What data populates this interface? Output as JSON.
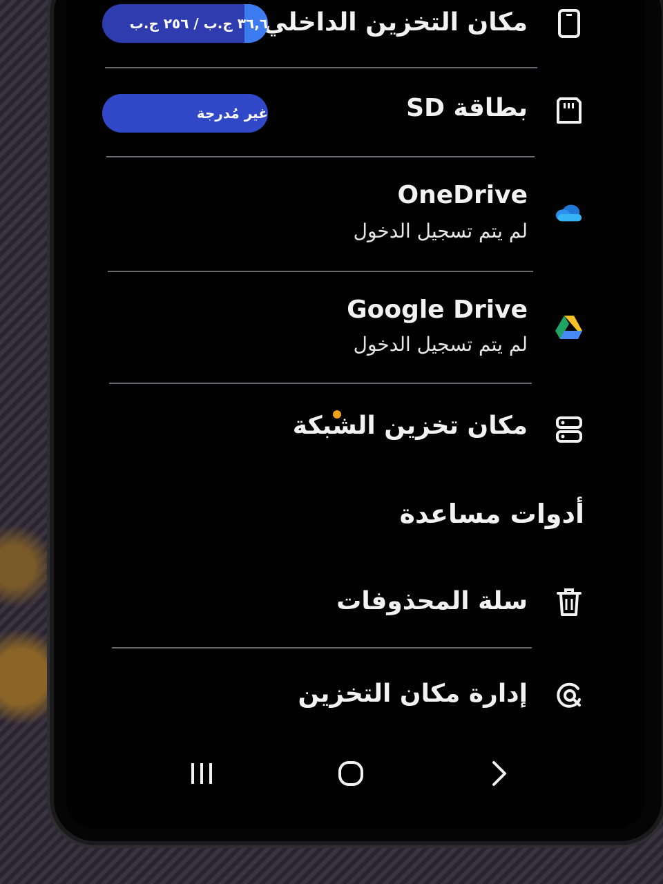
{
  "storage": {
    "internal": {
      "label": "مكان التخزين الداخلي",
      "usage": "٣٦,٦ ج.ب / ٢٥٦ ج.ب",
      "usage_fraction": 0.143
    },
    "sd_card": {
      "label": "بطاقة SD",
      "status": "غير مُدرجة"
    }
  },
  "cloud": {
    "onedrive": {
      "label": "OneDrive",
      "status": "لم يتم تسجيل الدخول"
    },
    "google_drive": {
      "label": "Google Drive",
      "status": "لم يتم تسجيل الدخول"
    }
  },
  "network_storage": {
    "label": "مكان تخزين الشبكة"
  },
  "utilities": {
    "title": "أدوات مساعدة",
    "trash_label": "سلة المحذوفات",
    "manage_label": "إدارة مكان التخزين"
  },
  "colors": {
    "pill_bg": "#2f3cb0",
    "pill_fill": "#3d7bf0",
    "notification_dot": "#f2a21e"
  },
  "icons": {
    "internal": "phone-icon",
    "sd": "sd-card-icon",
    "onedrive": "onedrive-cloud-icon",
    "gdrive": "google-drive-icon",
    "network": "network-storage-icon",
    "trash": "trash-icon",
    "manage": "storage-manage-icon"
  }
}
